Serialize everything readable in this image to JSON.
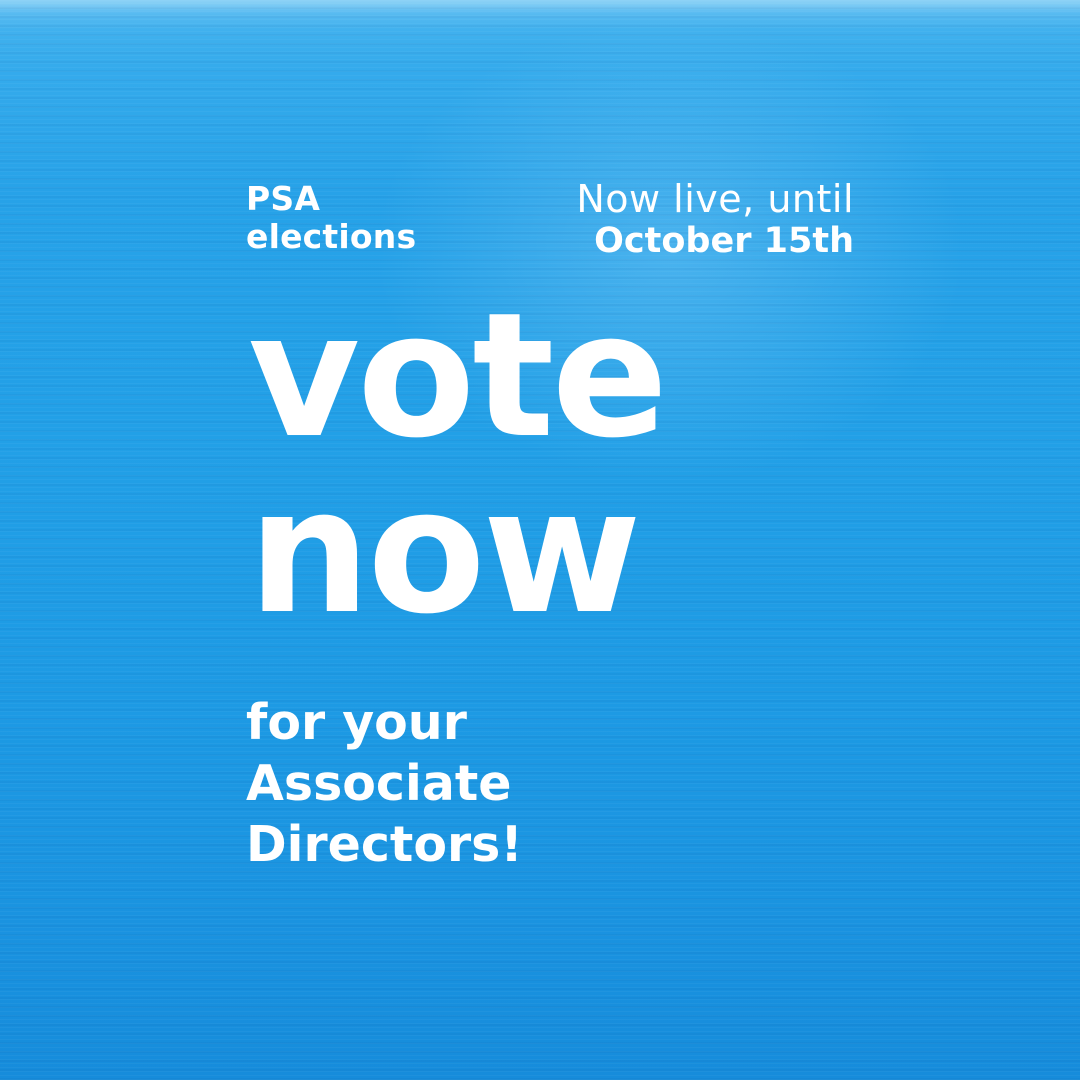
{
  "colors": {
    "background": "#22a0e7",
    "text": "#ffffff"
  },
  "header": {
    "org_line": "PSA",
    "event_line": "elections",
    "status_line": "Now live, until",
    "deadline_line": "October 15th"
  },
  "headline": {
    "line1": "vote",
    "line2": "now"
  },
  "subheadline": {
    "line1": "for your",
    "line2": "Associate",
    "line3": "Directors!"
  }
}
